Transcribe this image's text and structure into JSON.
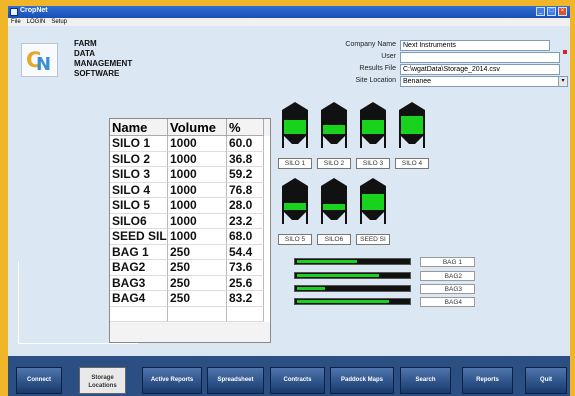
{
  "window": {
    "title": "CropNet"
  },
  "menu": {
    "items": [
      "File",
      "LOGIN",
      "Setup"
    ]
  },
  "brand": {
    "logo_letter_1": "C",
    "logo_letter_2": "N",
    "line1": "FARM",
    "line2": "DATA",
    "line3": "MANAGEMENT",
    "line4": "SOFTWARE"
  },
  "info": {
    "company_label": "Company Name",
    "company_value": "Next Instruments",
    "user_label": "User",
    "user_value": "",
    "results_label": "Results File",
    "results_value": "C:\\wgatData\\Storage_2014.csv",
    "site_label": "Site Location",
    "site_value": "Benanee"
  },
  "table": {
    "headers": [
      "Name",
      "Volume",
      "%"
    ],
    "rows": [
      [
        "SILO 1",
        "1000",
        "60.0"
      ],
      [
        "SILO 2",
        "1000",
        "36.8"
      ],
      [
        "SILO 3",
        "1000",
        "59.2"
      ],
      [
        "SILO 4",
        "1000",
        "76.8"
      ],
      [
        "SILO 5",
        "1000",
        "28.0"
      ],
      [
        "SILO6",
        "1000",
        "23.2"
      ],
      [
        "SEED SILO",
        "1000",
        "68.0"
      ],
      [
        "BAG 1",
        "250",
        "54.4"
      ],
      [
        "BAG2",
        "250",
        "73.6"
      ],
      [
        "BAG3",
        "250",
        "25.6"
      ],
      [
        "BAG4",
        "250",
        "83.2"
      ]
    ]
  },
  "silos": [
    {
      "label": "SILO 1",
      "level": 0.6
    },
    {
      "label": "SILO 2",
      "level": 0.368
    },
    {
      "label": "SILO 3",
      "level": 0.592
    },
    {
      "label": "SILO 4",
      "level": 0.768
    },
    {
      "label": "SILO 5",
      "level": 0.28
    },
    {
      "label": "SILO6",
      "level": 0.232
    },
    {
      "label": "SEED SI",
      "level": 0.68
    }
  ],
  "bags": [
    {
      "label": "BAG 1",
      "level": 0.544
    },
    {
      "label": "BAG2",
      "level": 0.736
    },
    {
      "label": "BAG3",
      "level": 0.256
    },
    {
      "label": "BAG4",
      "level": 0.832
    }
  ],
  "toolbar": {
    "connect": "Connect",
    "storage_1": "Storage",
    "storage_2": "Locations",
    "active_reports": "Active Reports",
    "spreadsheet": "Spreadsheet",
    "contracts": "Contracts",
    "paddock_maps": "Paddock Maps",
    "search": "Search",
    "reports": "Reports",
    "quit": "Quit"
  },
  "colors": {
    "fill_green": "#19d21e",
    "silo_black": "#111111"
  }
}
